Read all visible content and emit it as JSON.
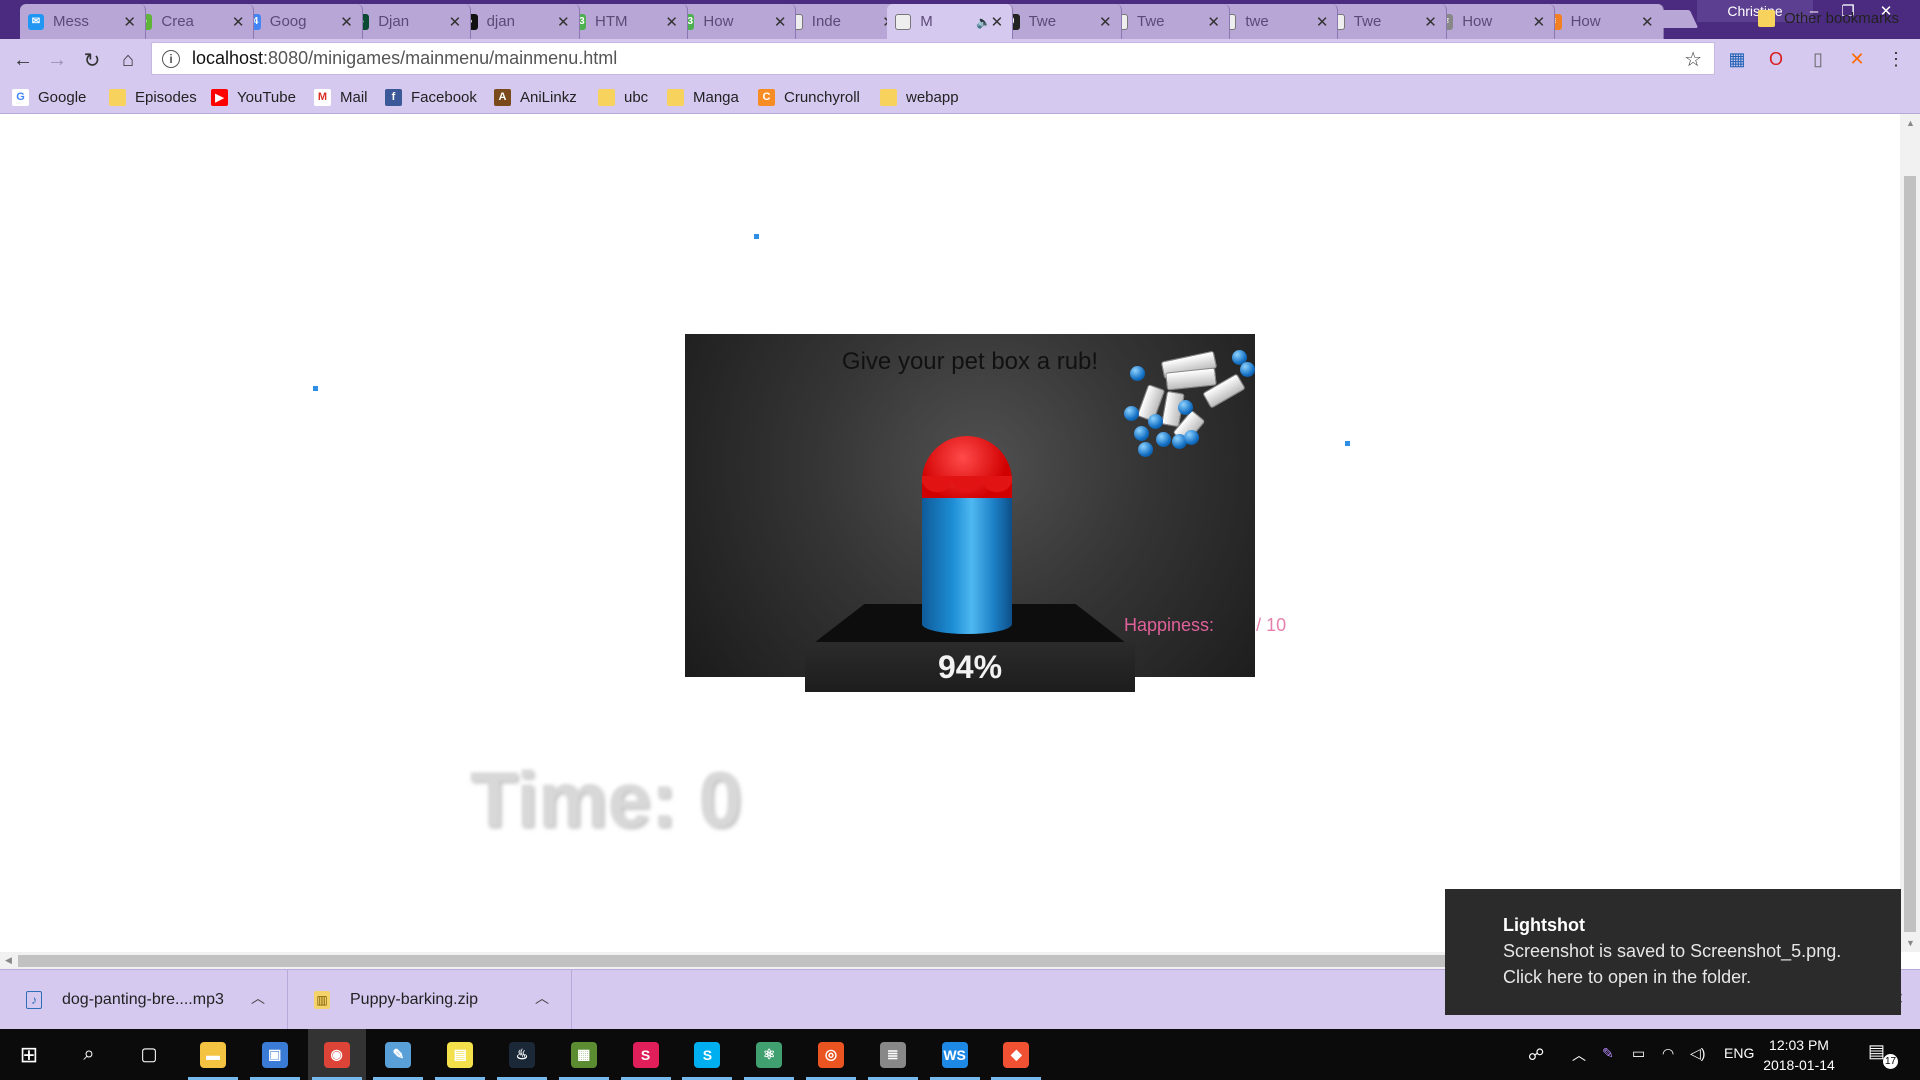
{
  "browser": {
    "profile_name": "Christine",
    "tabs": [
      {
        "title": "Mess",
        "icon": "messenger-icon",
        "color": "#2196f3",
        "glyph": "✉"
      },
      {
        "title": "Crea",
        "icon": "leaf-icon",
        "color": "#5fb43a",
        "glyph": "●"
      },
      {
        "title": "Goog",
        "icon": "google-calendar-icon",
        "color": "#4285f4",
        "glyph": "14"
      },
      {
        "title": "Djan",
        "icon": "django-icon",
        "color": "#0c4b33",
        "glyph": "♠"
      },
      {
        "title": "djan",
        "icon": "github-icon",
        "color": "#111111",
        "glyph": "●"
      },
      {
        "title": "HTM",
        "icon": "w3schools-icon",
        "color": "#4caf50",
        "glyph": "w3"
      },
      {
        "title": "How",
        "icon": "w3schools-icon",
        "color": "#4caf50",
        "glyph": "w3"
      },
      {
        "title": "Inde",
        "icon": "page-icon",
        "color": "#eeeeee",
        "glyph": ""
      },
      {
        "title": "M",
        "icon": "page-icon",
        "color": "#eeeeee",
        "glyph": "",
        "active": true,
        "audio": true
      },
      {
        "title": "Twe",
        "icon": "tweenjs-icon",
        "color": "#222222",
        "glyph": "0"
      },
      {
        "title": "Twe",
        "icon": "page-icon",
        "color": "#eeeeee",
        "glyph": ""
      },
      {
        "title": "twe",
        "icon": "page-icon",
        "color": "#eeeeee",
        "glyph": ""
      },
      {
        "title": "Twe",
        "icon": "page-icon",
        "color": "#eeeeee",
        "glyph": ""
      },
      {
        "title": "How",
        "icon": "atom-icon",
        "color": "#888888",
        "glyph": "⚛"
      },
      {
        "title": "How",
        "icon": "stackoverflow-icon",
        "color": "#f48024",
        "glyph": "≡"
      }
    ],
    "url_host": "localhost",
    "url_path": ":8080/minigames/mainmenu/mainmenu.html",
    "bookmarks": [
      {
        "label": "Google",
        "icon": "google-icon",
        "color": "#ffffff",
        "glyph": "G"
      },
      {
        "label": "Episodes",
        "icon": "folder-icon",
        "color": "#f7d35d",
        "glyph": ""
      },
      {
        "label": "YouTube",
        "icon": "youtube-icon",
        "color": "#ff0000",
        "glyph": "▶"
      },
      {
        "label": "Mail",
        "icon": "gmail-icon",
        "color": "#ffffff",
        "glyph": "M"
      },
      {
        "label": "Facebook",
        "icon": "facebook-icon",
        "color": "#3b5998",
        "glyph": "f"
      },
      {
        "label": "AniLinkz",
        "icon": "anilinkz-icon",
        "color": "#7a4a1a",
        "glyph": "A"
      },
      {
        "label": "ubc",
        "icon": "folder-icon",
        "color": "#f7d35d",
        "glyph": ""
      },
      {
        "label": "Manga",
        "icon": "folder-icon",
        "color": "#f7d35d",
        "glyph": ""
      },
      {
        "label": "Crunchyroll",
        "icon": "crunchyroll-icon",
        "color": "#f78c25",
        "glyph": "C"
      },
      {
        "label": "webapp",
        "icon": "folder-icon",
        "color": "#f7d35d",
        "glyph": ""
      }
    ],
    "other_bookmarks": "Other bookmarks"
  },
  "game": {
    "prompt": "Give your pet box a rub!",
    "progress": "94%",
    "progress_value": 0.94,
    "happiness_label": "Happiness:",
    "happiness_value": "",
    "happiness_max": "/ 10",
    "timer": "Time: 0"
  },
  "downloads": [
    {
      "name": "dog-panting-bre....mp3",
      "icon": "audio-file-icon"
    },
    {
      "name": "Puppy-barking.zip",
      "icon": "zip-file-icon"
    }
  ],
  "toast": {
    "title": "Lightshot",
    "line1": "Screenshot is saved to Screenshot_5.png.",
    "line2": "Click here to open in the folder."
  },
  "taskbar": {
    "apps": [
      {
        "name": "file-explorer-icon",
        "color": "#f5c342",
        "glyph": "▬"
      },
      {
        "name": "photos-icon",
        "color": "#3a7bd5",
        "glyph": "▣"
      },
      {
        "name": "chrome-icon",
        "color": "#db4437",
        "glyph": "◉",
        "active": true
      },
      {
        "name": "paint-icon",
        "color": "#5aa0d8",
        "glyph": "✎"
      },
      {
        "name": "sticky-notes-icon",
        "color": "#f3e04a",
        "glyph": "▤"
      },
      {
        "name": "steam-icon",
        "color": "#1b2838",
        "glyph": "♨"
      },
      {
        "name": "minecraft-icon",
        "color": "#5b8c32",
        "glyph": "▦"
      },
      {
        "name": "slack-icon",
        "color": "#e01e5a",
        "glyph": "S"
      },
      {
        "name": "skype-icon",
        "color": "#00aff0",
        "glyph": "S"
      },
      {
        "name": "atom-icon",
        "color": "#40a070",
        "glyph": "⚛"
      },
      {
        "name": "ubuntu-icon",
        "color": "#e95420",
        "glyph": "◎"
      },
      {
        "name": "database-icon",
        "color": "#888888",
        "glyph": "≣"
      },
      {
        "name": "webstorm-icon",
        "color": "#1e88e5",
        "glyph": "WS"
      },
      {
        "name": "git-icon",
        "color": "#f05133",
        "glyph": "◆"
      }
    ],
    "language": "ENG",
    "time": "12:03 PM",
    "date": "2018-01-14",
    "notifications": "17"
  }
}
